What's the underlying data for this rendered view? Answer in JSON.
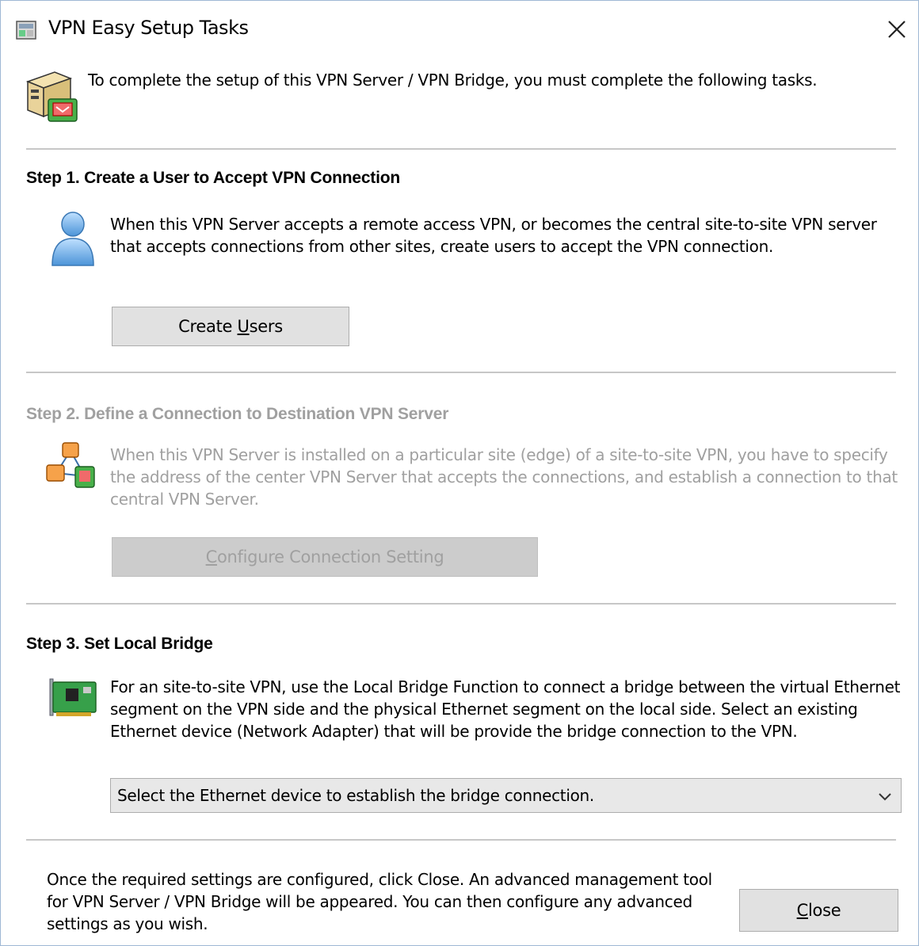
{
  "window": {
    "title": "VPN Easy Setup Tasks"
  },
  "intro": {
    "text": "To complete the setup of this VPN Server / VPN Bridge, you must complete the following tasks."
  },
  "step1": {
    "title": "Step 1. Create a User to Accept VPN Connection",
    "description": "When this VPN Server accepts a remote access VPN, or becomes the central site-to-site VPN server that accepts connections from other sites, create users to accept the VPN connection.",
    "button_prefix": "Create ",
    "button_mnemonic": "U",
    "button_suffix": "sers"
  },
  "step2": {
    "title": "Step 2. Define a Connection to Destination VPN Server",
    "description": "When this VPN Server is installed on a particular site (edge) of a site-to-site VPN, you have to specify the address of the center VPN Server that accepts the connections, and establish a connection to that central VPN Server.",
    "button_mnemonic": "C",
    "button_suffix": "onfigure Connection Setting",
    "enabled": false
  },
  "step3": {
    "title": "Step 3. Set Local Bridge",
    "description": "For an site-to-site VPN, use the Local Bridge Function to connect a bridge between the virtual Ethernet segment on the VPN side and the physical Ethernet segment on the local side. Select an existing Ethernet device (Network Adapter) that will be provide the bridge connection to the VPN.",
    "select_value": "Select the Ethernet device to establish the bridge connection."
  },
  "footer": {
    "text": "Once the required settings are configured, click Close. An advanced management tool for VPN Server / VPN Bridge will be appeared. You can then configure any advanced settings as you wish.",
    "close_mnemonic": "C",
    "close_suffix": "lose"
  }
}
